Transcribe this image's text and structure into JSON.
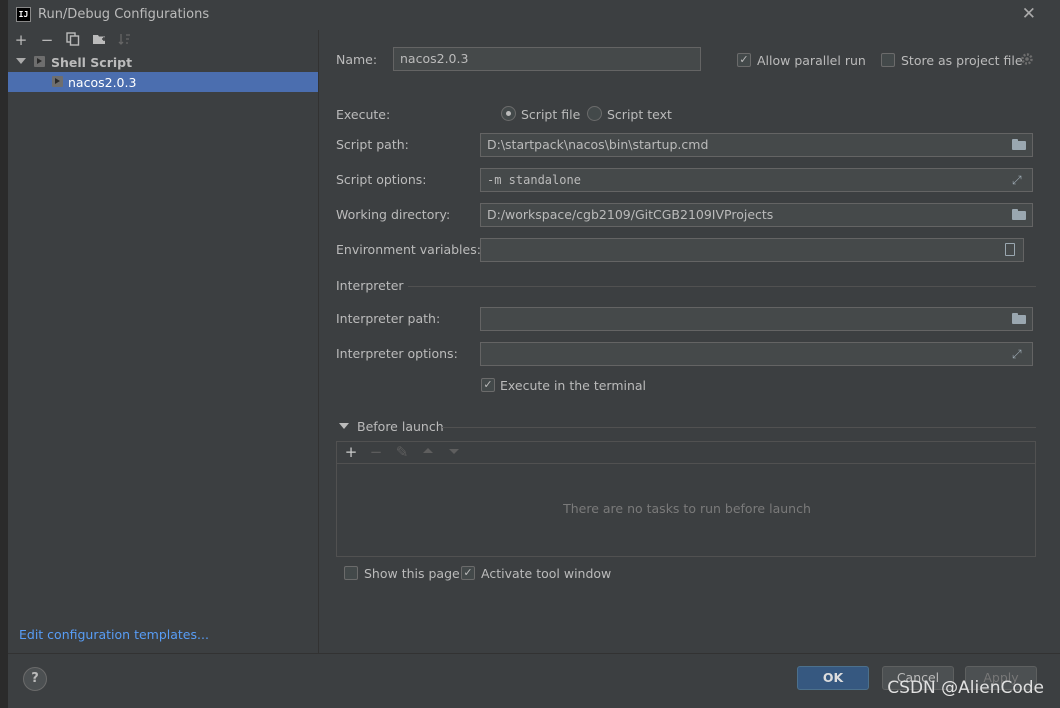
{
  "window": {
    "title": "Run/Debug Configurations",
    "app_icon_text": "IJ"
  },
  "left_toolbar": {
    "icons": [
      "add-icon",
      "remove-icon",
      "copy-icon",
      "new-folder-icon",
      "sort-icon"
    ]
  },
  "tree": {
    "group_label": "Shell Script",
    "items": [
      {
        "label": "nacos2.0.3"
      }
    ]
  },
  "edit_templates_link": "Edit configuration templates...",
  "form": {
    "name_label": "Name:",
    "name_value": "nacos2.0.3",
    "allow_parallel_label": "Allow parallel run",
    "allow_parallel_checked": true,
    "store_project_label": "Store as project file",
    "store_project_checked": false,
    "execute_label": "Execute:",
    "script_file_label": "Script file",
    "script_text_label": "Script text",
    "execute_selected": "Script file",
    "script_path_label": "Script path:",
    "script_path_value": "D:\\startpack\\nacos\\bin\\startup.cmd",
    "script_options_label": "Script options:",
    "script_options_value": "-m standalone",
    "working_dir_label": "Working directory:",
    "working_dir_value": "D:/workspace/cgb2109/GitCGB2109IVProjects",
    "env_vars_label": "Environment variables:",
    "env_vars_value": "",
    "interpreter_section": "Interpreter",
    "interpreter_path_label": "Interpreter path:",
    "interpreter_path_value": "",
    "interpreter_options_label": "Interpreter options:",
    "interpreter_options_value": "",
    "execute_terminal_label": "Execute in the terminal",
    "execute_terminal_checked": true
  },
  "before_launch": {
    "section_label": "Before launch",
    "empty_text": "There are no tasks to run before launch",
    "toolbar_icons": [
      "add-icon",
      "remove-icon",
      "edit-icon",
      "move-up-icon",
      "move-down-icon"
    ]
  },
  "options": {
    "show_page_label": "Show this page",
    "show_page_checked": false,
    "activate_tool_label": "Activate tool window",
    "activate_tool_checked": true
  },
  "buttons": {
    "help": "?",
    "ok": "OK",
    "cancel": "Cancel",
    "apply": "Apply"
  },
  "watermark": "CSDN @AlienCode",
  "colors": {
    "background": "#3c3f41",
    "selection": "#4b6eaf",
    "link": "#589df6",
    "primary_button": "#365880"
  }
}
